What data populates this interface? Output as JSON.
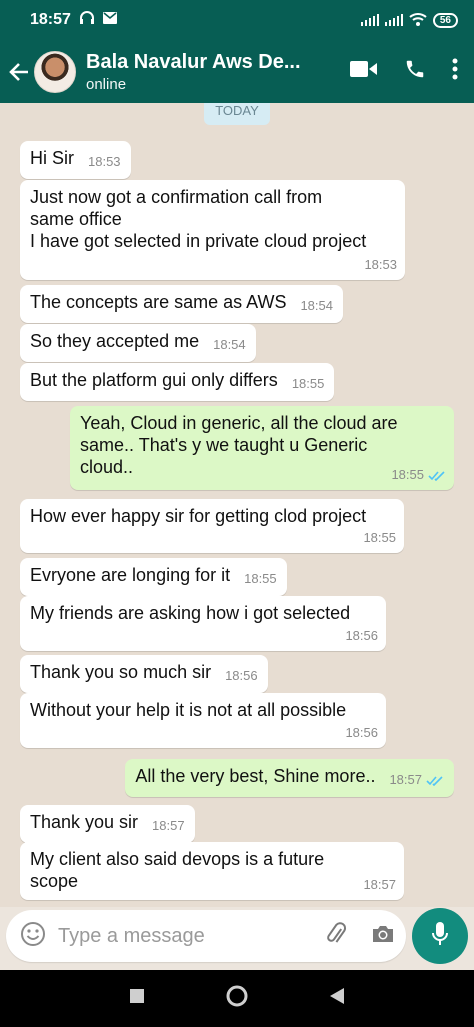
{
  "status_bar": {
    "time": "18:57",
    "battery": "56",
    "icons": [
      "headphones-icon",
      "message-icon",
      "signal-icon",
      "signal-icon",
      "wifi-icon",
      "battery-icon"
    ]
  },
  "header": {
    "contact_name": "Bala Navalur Aws De...",
    "status": "online",
    "icons": [
      "back-arrow-icon",
      "video-call-icon",
      "phone-icon",
      "more-vert-icon"
    ]
  },
  "chat": {
    "date_chip": "TODAY",
    "messages": [
      {
        "dir": "in",
        "text": "Hi Sir",
        "time": "18:53"
      },
      {
        "dir": "in",
        "text": "Just now got a confirmation call from\nsame office\nI have got selected in private cloud project",
        "time": "18:53"
      },
      {
        "dir": "in",
        "text": "The concepts are same as AWS",
        "time": "18:54"
      },
      {
        "dir": "in",
        "text": "So they accepted me",
        "time": "18:54"
      },
      {
        "dir": "in",
        "text": "But the platform gui only differs",
        "time": "18:55"
      },
      {
        "dir": "out",
        "text": "Yeah, Cloud in generic, all the cloud are\nsame.. That's y we taught u Generic\ncloud..",
        "time": "18:55",
        "status": "read"
      },
      {
        "dir": "in",
        "text": "How ever happy sir for getting clod project",
        "time": "18:55"
      },
      {
        "dir": "in",
        "text": "Evryone are longing for it",
        "time": "18:55"
      },
      {
        "dir": "in",
        "text": "My friends are asking how i got selected",
        "time": "18:56"
      },
      {
        "dir": "in",
        "text": "Thank you so much sir",
        "time": "18:56"
      },
      {
        "dir": "in",
        "text": "Without your help it is not at all possible",
        "time": "18:56"
      },
      {
        "dir": "out",
        "text": "All the very best, Shine more..",
        "time": "18:57",
        "status": "read"
      },
      {
        "dir": "in",
        "text": "Thank you sir",
        "time": "18:57"
      },
      {
        "dir": "in",
        "text": "My client also said devops is a future\nscope",
        "time": "18:57"
      }
    ]
  },
  "input": {
    "placeholder": "Type a message",
    "value": ""
  },
  "colors": {
    "header": "#075e54",
    "outgoing_bubble": "#dcf8c6",
    "incoming_bubble": "#ffffff",
    "read_ticks": "#4fc3f7",
    "mic_button": "#128c7e"
  }
}
